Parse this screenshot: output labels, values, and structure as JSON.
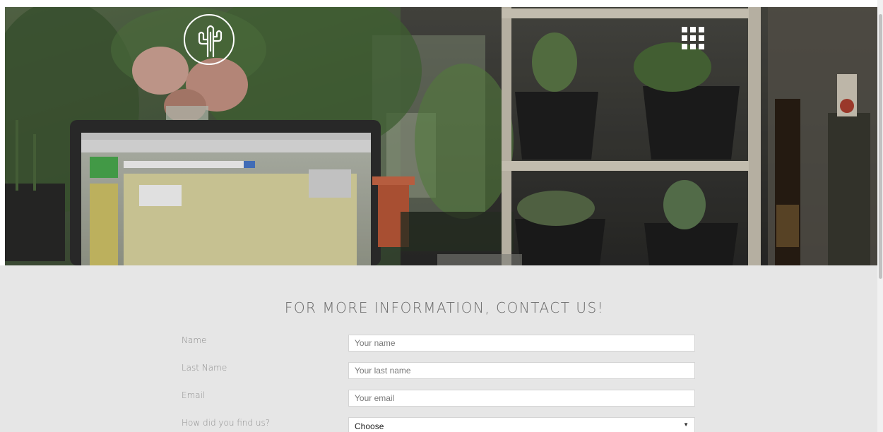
{
  "hero": {
    "logo_icon": "cactus-icon",
    "menu_icon": "grid-icon"
  },
  "contact": {
    "title": "FOR MORE INFORMATION, CONTACT US!",
    "fields": [
      {
        "label": "Name",
        "placeholder": "Your name"
      },
      {
        "label": "Last Name",
        "placeholder": "Your last name"
      },
      {
        "label": "Email",
        "placeholder": "Your email"
      }
    ],
    "source": {
      "label": "How did you find us?",
      "value": "Choose",
      "caret_icon": "caret-down-icon"
    }
  },
  "colors": {
    "section_bg": "#e6e6e6",
    "title": "#6b6b6b",
    "label": "#8e8e8e"
  }
}
